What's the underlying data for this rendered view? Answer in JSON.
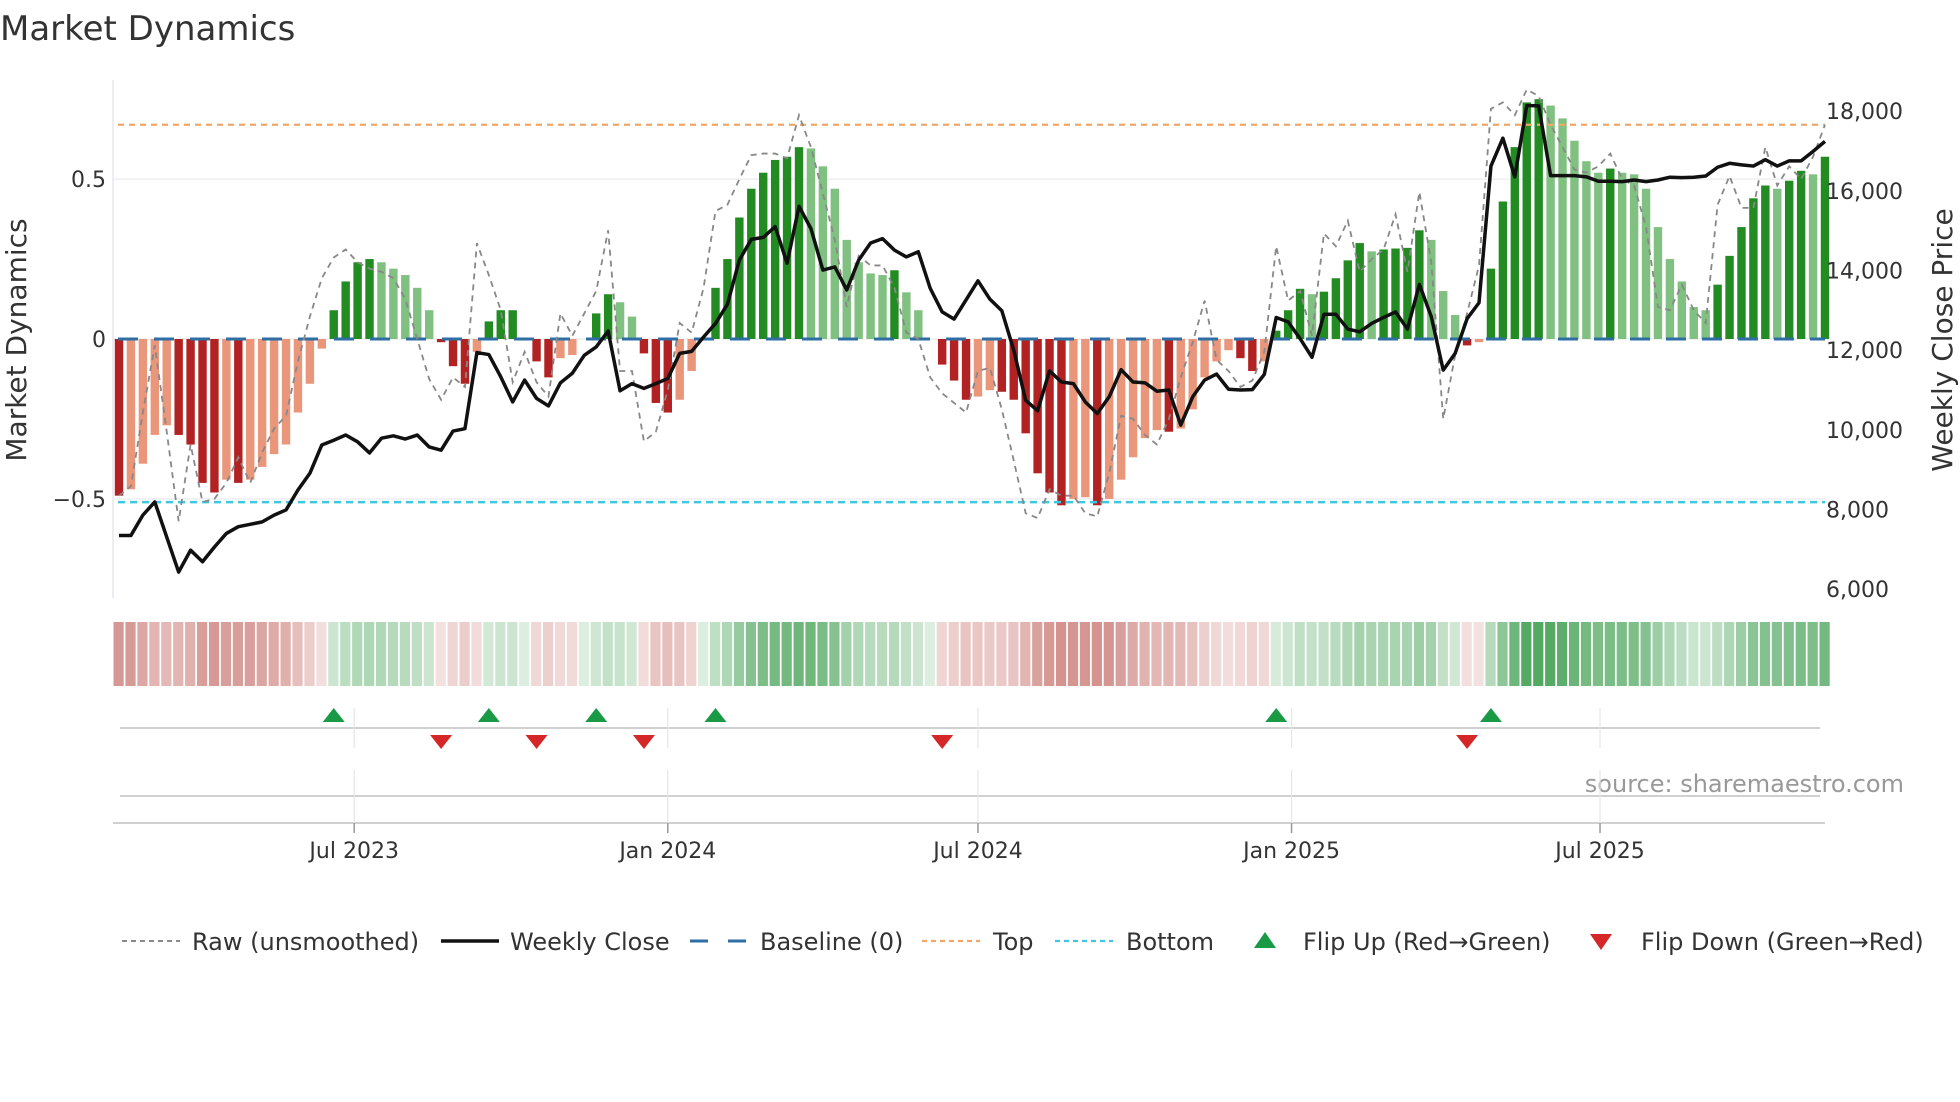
{
  "chart_data": {
    "type": "bar",
    "title": "Market Dynamics",
    "ylabel_left": "Market Dynamics",
    "ylabel_right": "Weekly Close Price",
    "source": "source: sharemaestro.com",
    "start_date": "2023-02-13",
    "frequency": "weekly",
    "ylim_left": [
      -0.81,
      0.81
    ],
    "ylim_right": [
      5780,
      18780
    ],
    "left_ticks": [
      {
        "value": 0.5,
        "label": "0.5"
      },
      {
        "value": 0,
        "label": "0"
      },
      {
        "value": -0.5,
        "label": "−0.5"
      }
    ],
    "right_ticks": [
      {
        "value": 6000,
        "label": "6,000"
      },
      {
        "value": 8000,
        "label": "8,000"
      },
      {
        "value": 10000,
        "label": "10,000"
      },
      {
        "value": 12000,
        "label": "12,000"
      },
      {
        "value": 14000,
        "label": "14,000"
      },
      {
        "value": 16000,
        "label": "16,000"
      },
      {
        "value": 18000,
        "label": "18,000"
      }
    ],
    "x_ticks": [
      {
        "date": "2023-07-01",
        "label": "Jul 2023"
      },
      {
        "date": "2024-01-01",
        "label": "Jan 2024"
      },
      {
        "date": "2024-07-01",
        "label": "Jul 2024"
      },
      {
        "date": "2025-01-01",
        "label": "Jan 2025"
      },
      {
        "date": "2025-07-01",
        "label": "Jul 2025"
      }
    ],
    "top_level": 0.67,
    "bottom_level": -0.51,
    "baseline": 0,
    "values": [
      -0.49,
      -0.47,
      -0.39,
      -0.3,
      -0.27,
      -0.3,
      -0.33,
      -0.45,
      -0.48,
      -0.44,
      -0.45,
      -0.44,
      -0.4,
      -0.36,
      -0.33,
      -0.23,
      -0.14,
      -0.03,
      0.09,
      0.18,
      0.24,
      0.25,
      0.24,
      0.22,
      0.2,
      0.16,
      0.09,
      -0.01,
      -0.085,
      -0.14,
      -0.04,
      0.055,
      0.09,
      0.09,
      0.0,
      -0.07,
      -0.12,
      -0.06,
      -0.05,
      0.0,
      0.08,
      0.14,
      0.115,
      0.07,
      -0.045,
      -0.2,
      -0.23,
      -0.19,
      -0.1,
      0.0,
      0.16,
      0.25,
      0.38,
      0.47,
      0.52,
      0.56,
      0.57,
      0.6,
      0.596,
      0.54,
      0.47,
      0.31,
      0.24,
      0.205,
      0.2,
      0.215,
      0.146,
      0.09,
      0.0,
      -0.08,
      -0.13,
      -0.19,
      -0.18,
      -0.16,
      -0.165,
      -0.19,
      -0.295,
      -0.42,
      -0.48,
      -0.52,
      -0.5,
      -0.495,
      -0.52,
      -0.5,
      -0.44,
      -0.37,
      -0.31,
      -0.285,
      -0.29,
      -0.28,
      -0.22,
      -0.12,
      -0.07,
      -0.035,
      -0.06,
      -0.1,
      -0.07,
      0.026,
      0.09,
      0.157,
      0.14,
      0.148,
      0.19,
      0.246,
      0.3,
      0.274,
      0.28,
      0.283,
      0.285,
      0.34,
      0.31,
      0.15,
      0.075,
      -0.02,
      -0.01,
      0.22,
      0.43,
      0.6,
      0.74,
      0.75,
      0.73,
      0.69,
      0.62,
      0.556,
      0.52,
      0.533,
      0.52,
      0.515,
      0.47,
      0.35,
      0.25,
      0.18,
      0.1,
      0.09,
      0.17,
      0.26,
      0.35,
      0.44,
      0.48,
      0.47,
      0.495,
      0.526,
      0.515,
      0.57
    ],
    "raw": [
      -0.49,
      -0.46,
      -0.23,
      -0.02,
      -0.29,
      -0.57,
      -0.33,
      -0.51,
      -0.5,
      -0.45,
      -0.37,
      -0.45,
      -0.355,
      -0.28,
      -0.24,
      -0.07,
      0.07,
      0.19,
      0.255,
      0.28,
      0.24,
      0.22,
      0.21,
      0.19,
      0.125,
      0.0,
      -0.125,
      -0.19,
      -0.12,
      -0.15,
      0.3,
      0.2,
      0.09,
      -0.135,
      -0.04,
      -0.135,
      -0.18,
      0.08,
      0.01,
      0.08,
      0.15,
      0.34,
      -0.1,
      -0.1,
      -0.32,
      -0.29,
      -0.16,
      0.05,
      0.02,
      0.16,
      0.4,
      0.42,
      0.5,
      0.575,
      0.58,
      0.58,
      0.565,
      0.7,
      0.6,
      0.455,
      0.31,
      0.1,
      0.26,
      0.23,
      0.23,
      0.16,
      0.02,
      0.0,
      -0.12,
      -0.17,
      -0.2,
      -0.23,
      -0.1,
      -0.09,
      -0.22,
      -0.38,
      -0.545,
      -0.56,
      -0.47,
      -0.49,
      -0.49,
      -0.545,
      -0.555,
      -0.42,
      -0.24,
      -0.25,
      -0.3,
      -0.33,
      -0.25,
      -0.12,
      -0.01,
      0.12,
      -0.065,
      -0.1,
      -0.15,
      -0.13,
      -0.04,
      0.29,
      0.12,
      0.15,
      0.01,
      0.33,
      0.29,
      0.37,
      0.21,
      0.25,
      0.28,
      0.39,
      0.21,
      0.46,
      0.24,
      -0.25,
      -0.05,
      0.08,
      0.23,
      0.72,
      0.74,
      0.7,
      0.78,
      0.76,
      0.67,
      0.6,
      0.53,
      0.52,
      0.54,
      0.58,
      0.5,
      0.48,
      0.35,
      0.1,
      0.09,
      0.17,
      0.09,
      0.05,
      0.42,
      0.51,
      0.41,
      0.41,
      0.6,
      0.48,
      0.54,
      0.5,
      0.57,
      0.67
    ],
    "weekly_close": [
      7350,
      7350,
      7860,
      8190,
      7310,
      6430,
      6980,
      6690,
      7060,
      7400,
      7570,
      7630,
      7690,
      7860,
      7990,
      8490,
      8910,
      9620,
      9740,
      9870,
      9700,
      9420,
      9790,
      9850,
      9770,
      9870,
      9570,
      9490,
      9970,
      10030,
      11940,
      11890,
      11330,
      10700,
      11250,
      10790,
      10600,
      11180,
      11420,
      11870,
      12080,
      12480,
      10980,
      11160,
      11040,
      11160,
      11290,
      11920,
      11970,
      12330,
      12670,
      13150,
      14260,
      14780,
      14830,
      15100,
      14180,
      15610,
      15050,
      14010,
      14090,
      13510,
      14260,
      14690,
      14800,
      14510,
      14340,
      14470,
      13550,
      12960,
      12780,
      13260,
      13740,
      13280,
      12990,
      12000,
      10740,
      10480,
      11480,
      11200,
      11160,
      10700,
      10410,
      10830,
      11510,
      11200,
      11180,
      10970,
      11000,
      10120,
      10830,
      11250,
      11400,
      11020,
      11000,
      11010,
      11390,
      12820,
      12710,
      12290,
      11820,
      12900,
      12900,
      12530,
      12460,
      12670,
      12820,
      12960,
      12530,
      13650,
      12840,
      11500,
      11920,
      12790,
      13190,
      16620,
      17320,
      16350,
      18140,
      18130,
      16380,
      16380,
      16380,
      16350,
      16240,
      16240,
      16230,
      16270,
      16230,
      16270,
      16340,
      16330,
      16340,
      16370,
      16590,
      16690,
      16650,
      16620,
      16780,
      16620,
      16750,
      16750,
      16990,
      17240
    ],
    "flip_up_weeks": [
      19,
      32,
      41,
      51,
      98,
      116
    ],
    "flip_down_weeks": [
      28,
      36,
      45,
      70,
      114
    ],
    "legend": [
      {
        "key": "raw",
        "label": "Raw (unsmoothed)"
      },
      {
        "key": "close",
        "label": "Weekly Close"
      },
      {
        "key": "baseline",
        "label": "Baseline (0)"
      },
      {
        "key": "top",
        "label": "Top"
      },
      {
        "key": "bottom",
        "label": "Bottom"
      },
      {
        "key": "flip_up",
        "label": "Flip Up (Red→Green)"
      },
      {
        "key": "flip_down",
        "label": "Flip Down (Green→Red)"
      }
    ],
    "legend_position": "bottom",
    "colors": {
      "bar_pos_strong": "#228b22",
      "bar_pos_weak": "#80c080",
      "bar_neg_strong": "#b22222",
      "bar_neg_weak": "#e9967a",
      "raw": "#888888",
      "close": "#111111",
      "baseline": "#2f6ea5",
      "top": "#f0a868",
      "bottom": "#3ec8e0",
      "flip_up": "#1a9a45",
      "flip_down": "#d62728",
      "strip_pos": "#3f9f50",
      "strip_neg": "#c0605a"
    }
  }
}
